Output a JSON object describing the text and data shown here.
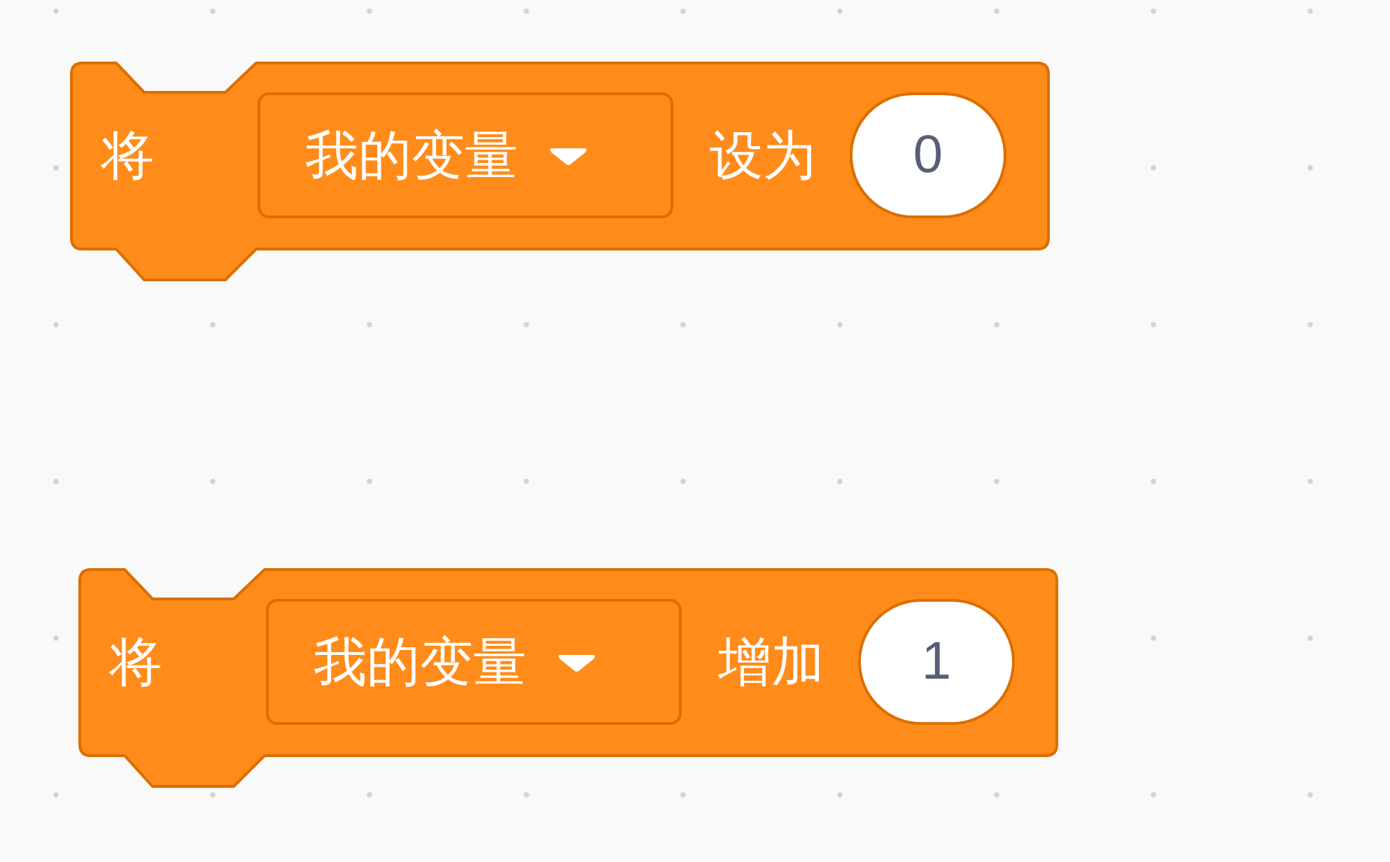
{
  "blocks": [
    {
      "kind": "command",
      "label": "将",
      "variable": "我的变量",
      "action": "设为",
      "value": "0"
    },
    {
      "kind": "command",
      "label": "将",
      "variable": "我的变量",
      "action": "增加",
      "value": "1"
    }
  ]
}
